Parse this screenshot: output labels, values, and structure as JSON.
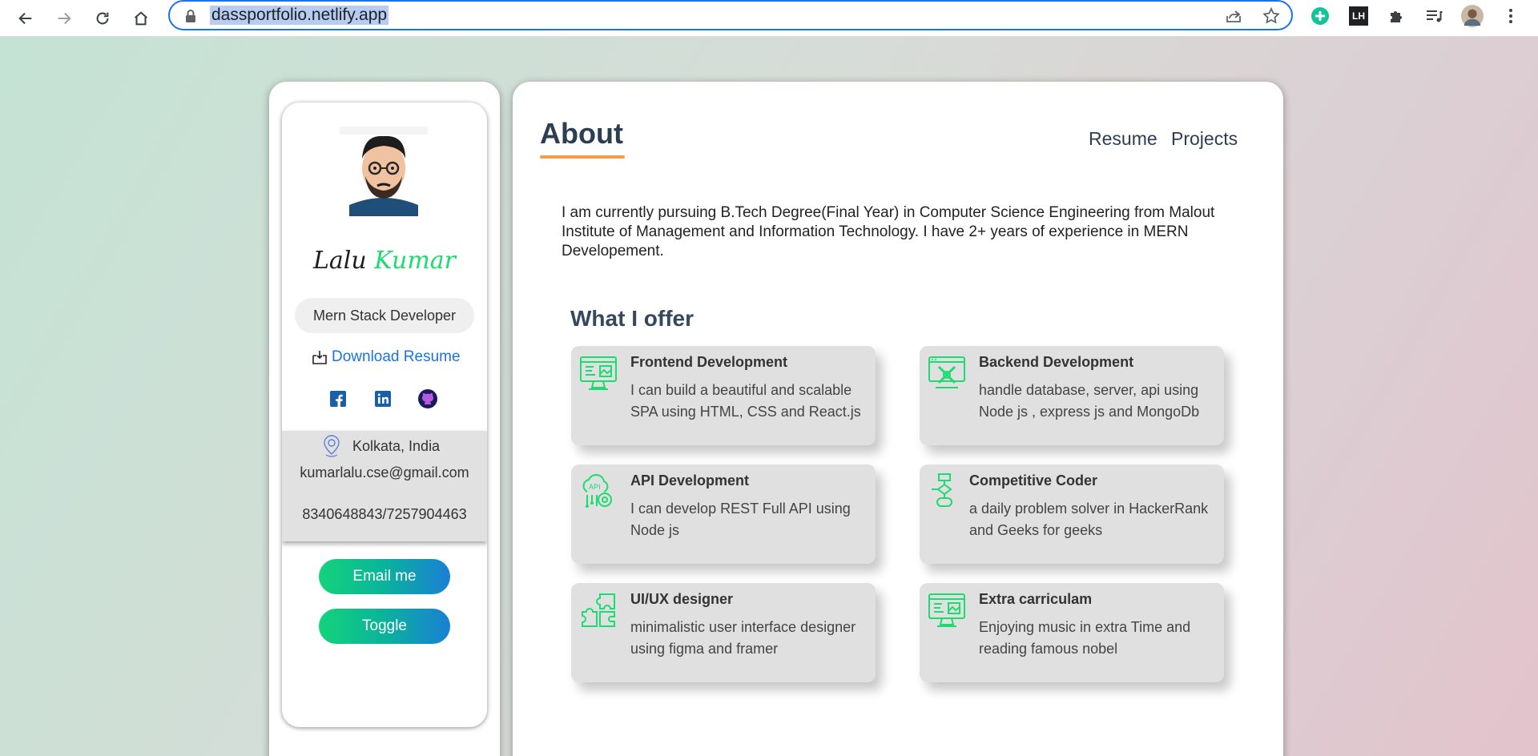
{
  "browser": {
    "url": "dassportfolio.netlify.app",
    "extensions": [
      "grammarly-icon",
      "lighthouse-icon",
      "puzzle-icon",
      "media-icon",
      "profile-avatar",
      "kebab-menu-icon"
    ],
    "extension_lh_text": "LH"
  },
  "profile": {
    "first_name": "Lalu",
    "last_name": "Kumar",
    "role": "Mern Stack Developer",
    "download_label": "Download Resume",
    "location": "Kolkata, India",
    "email": "kumarlalu.cse@gmail.com",
    "phone": "8340648843/7257904463",
    "email_button": "Email me",
    "toggle_button": "Toggle",
    "accent_color": "#1bdc6f"
  },
  "main": {
    "title": "About",
    "nav": [
      "Resume",
      "Projects"
    ],
    "bio": "I am currently pursuing B.Tech Degree(Final Year) in Computer Science Engineering from Malout Institute of Management and Information Technology. I have 2+ years of experience in MERN Developement.",
    "offer_title": "What I offer",
    "services": [
      {
        "title": "Frontend Development",
        "desc": "I can build a beautiful and scalable SPA using HTML, CSS and React.js",
        "icon": "monitor-code-icon"
      },
      {
        "title": "Backend Development",
        "desc": "handle database, server, api using Node js , express js and MongoDb",
        "icon": "server-tools-icon"
      },
      {
        "title": "API Development",
        "desc": "I can develop REST Full API using Node js",
        "icon": "api-gear-icon"
      },
      {
        "title": "Competitive Coder",
        "desc": "a daily problem solver in HackerRank and Geeks for geeks",
        "icon": "flowchart-icon"
      },
      {
        "title": "UI/UX designer",
        "desc": "minimalistic user interface designer using figma and framer",
        "icon": "puzzle-icon"
      },
      {
        "title": "Extra carriculam",
        "desc": "Enjoying music in extra Time and reading famous nobel",
        "icon": "monitor-design-icon"
      }
    ],
    "accent_color": "#f39c4a",
    "icon_color": "#1bdc6f"
  }
}
